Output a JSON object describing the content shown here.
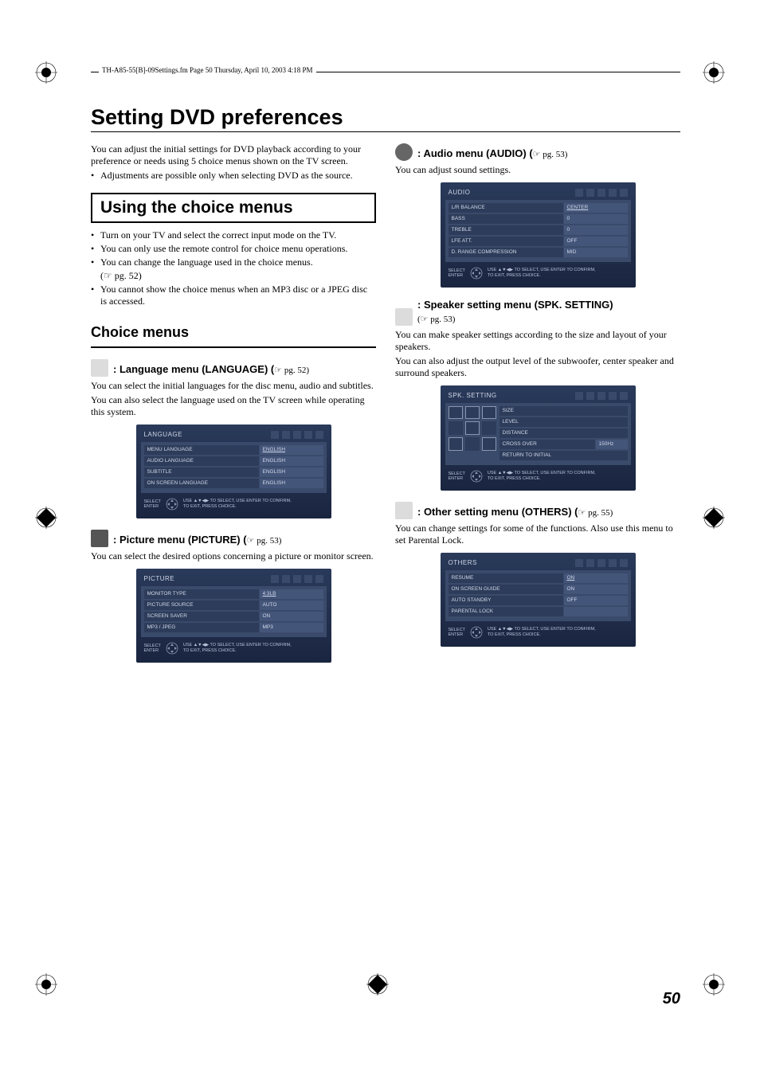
{
  "header": "TH-A85-55[B]-09Settings.fm  Page 50  Thursday, April 10, 2003  4:18 PM",
  "title": "Setting DVD preferences",
  "intro1": "You can adjust the initial settings for DVD playback according to your preference or needs using 5 choice menus shown on the TV screen.",
  "intro_bullet": "Adjustments are possible only when selecting DVD as the source.",
  "boxHeading": "Using the choice menus",
  "choiceBullets": [
    "Turn on your TV and select the correct input mode on the TV.",
    "You can only use the remote control for choice menu operations.",
    "You can change the language used in the choice menus.",
    "(☞ pg. 52)",
    "You cannot show the choice menus when an MP3 disc or a JPEG disc is accessed."
  ],
  "subHeading": "Choice menus",
  "lang": {
    "title": ": Language menu (LANGUAGE) (",
    "pg": "☞ pg. 52)",
    "p1": "You can select the initial languages for the disc menu, audio and subtitles.",
    "p2": "You can also select the language used on the TV screen while operating this system.",
    "osdTitle": "LANGUAGE",
    "rows": [
      {
        "label": "MENU LANGUAGE",
        "val": "ENGLISH"
      },
      {
        "label": "AUDIO LANGUAGE",
        "val": "ENGLISH"
      },
      {
        "label": "SUBTITLE",
        "val": "ENGLISH"
      },
      {
        "label": "ON SCREEN LANGUAGE",
        "val": "ENGLISH"
      }
    ]
  },
  "picture": {
    "title": ": Picture menu (PICTURE) (",
    "pg": "☞ pg. 53)",
    "p1": "You can select the desired options concerning a picture or monitor screen.",
    "osdTitle": "PICTURE",
    "rows": [
      {
        "label": "MONITOR TYPE",
        "val": "4:3LB"
      },
      {
        "label": "PICTURE SOURCE",
        "val": "AUTO"
      },
      {
        "label": "SCREEN SAVER",
        "val": "ON"
      },
      {
        "label": "MP3 / JPEG",
        "val": "MP3"
      }
    ]
  },
  "audio": {
    "title": ": Audio menu (AUDIO) (",
    "pg": "☞ pg. 53)",
    "p1": "You can adjust sound settings.",
    "osdTitle": "AUDIO",
    "rows": [
      {
        "label": "L/R BALANCE",
        "val": "CENTER"
      },
      {
        "label": "BASS",
        "val": "0"
      },
      {
        "label": "TREBLE",
        "val": "0"
      },
      {
        "label": "LFE ATT.",
        "val": "OFF"
      },
      {
        "label": "D. RANGE COMPRESSION",
        "val": "MID"
      }
    ]
  },
  "spk": {
    "title": ": Speaker setting menu (SPK. SETTING)",
    "pg": "(☞ pg. 53)",
    "p1": "You can make speaker settings according to the size and layout of your speakers.",
    "p2": "You can also adjust the output level of the subwoofer, center speaker and surround speakers.",
    "osdTitle": "SPK. SETTING",
    "rows": [
      {
        "label": "SIZE",
        "val": ""
      },
      {
        "label": "LEVEL",
        "val": ""
      },
      {
        "label": "DISTANCE",
        "val": ""
      },
      {
        "label": "CROSS OVER",
        "val": "150Hz"
      },
      {
        "label": "RETURN TO INITIAL",
        "val": ""
      }
    ]
  },
  "others": {
    "title": ": Other setting menu (OTHERS) (",
    "pg": "☞ pg. 55)",
    "p1": "You can change settings for some of the functions. Also use this menu to set Parental Lock.",
    "osdTitle": "OTHERS",
    "rows": [
      {
        "label": "RESUME",
        "val": "ON"
      },
      {
        "label": "ON SCREEN GUIDE",
        "val": "ON"
      },
      {
        "label": "AUTO STANDBY",
        "val": "OFF"
      },
      {
        "label": "PARENTAL LOCK",
        "val": ""
      }
    ]
  },
  "osdFooter": {
    "labels": "SELECT\nENTER",
    "hint": "USE ▲▼◀▶ TO SELECT,  USE ENTER TO CONFIRM,\nTO EXIT, PRESS CHOICE."
  },
  "pageNum": "50"
}
